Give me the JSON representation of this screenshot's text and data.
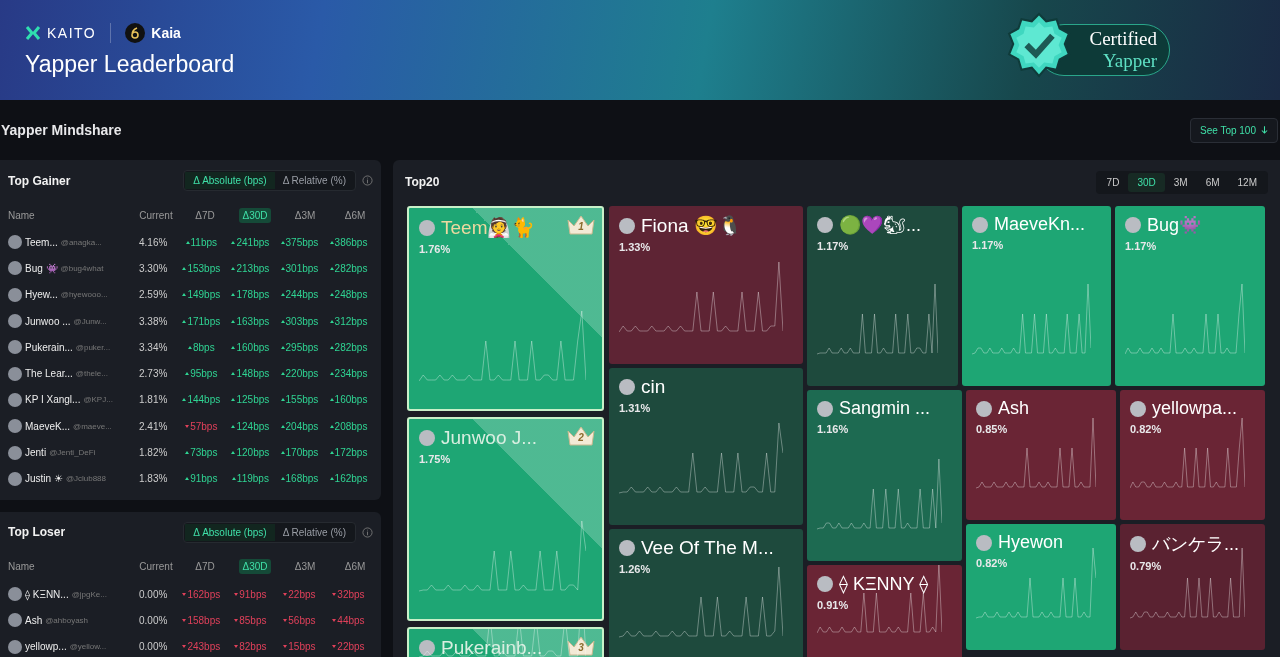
{
  "header": {
    "brand": "KAITO",
    "partner": "Kaia",
    "title": "Yapper Leaderboard",
    "badge": {
      "line1": "Certified",
      "line2": "Yapper"
    }
  },
  "section_title": "Yapper Mindshare",
  "see_top_button": "See Top 100",
  "panels": [
    {
      "title": "Top Gainer",
      "toggle": [
        {
          "label": "Δ Absolute (bps)",
          "selected": true
        },
        {
          "label": "Δ Relative (%)",
          "selected": false
        }
      ],
      "columns": [
        {
          "label": "Name",
          "selected": false
        },
        {
          "label": "Current",
          "selected": false
        },
        {
          "label": "Δ7D",
          "selected": false
        },
        {
          "label": "Δ30D",
          "selected": true
        },
        {
          "label": "Δ3M",
          "selected": false
        },
        {
          "label": "Δ6M",
          "selected": false
        }
      ],
      "rows": [
        {
          "name": "Teem...",
          "handle": "@anagka...",
          "current": "4.16%",
          "changes": [
            {
              "value": "11bps",
              "up": true
            },
            {
              "value": "241bps",
              "up": true
            },
            {
              "value": "375bps",
              "up": true
            },
            {
              "value": "386bps",
              "up": true
            }
          ]
        },
        {
          "name": "Bug 👾",
          "handle": "@bug4what",
          "current": "3.30%",
          "changes": [
            {
              "value": "153bps",
              "up": true
            },
            {
              "value": "213bps",
              "up": true
            },
            {
              "value": "301bps",
              "up": true
            },
            {
              "value": "282bps",
              "up": true
            }
          ]
        },
        {
          "name": "Hyew...",
          "handle": "@hyewooo...",
          "current": "2.59%",
          "changes": [
            {
              "value": "149bps",
              "up": true
            },
            {
              "value": "178bps",
              "up": true
            },
            {
              "value": "244bps",
              "up": true
            },
            {
              "value": "248bps",
              "up": true
            }
          ]
        },
        {
          "name": "Junwoo ...",
          "handle": "@Junw...",
          "current": "3.38%",
          "changes": [
            {
              "value": "171bps",
              "up": true
            },
            {
              "value": "163bps",
              "up": true
            },
            {
              "value": "303bps",
              "up": true
            },
            {
              "value": "312bps",
              "up": true
            }
          ]
        },
        {
          "name": "Pukerain...",
          "handle": "@puker...",
          "current": "3.34%",
          "changes": [
            {
              "value": "8bps",
              "up": true
            },
            {
              "value": "160bps",
              "up": true
            },
            {
              "value": "295bps",
              "up": true
            },
            {
              "value": "282bps",
              "up": true
            }
          ]
        },
        {
          "name": "The Lear...",
          "handle": "@thele...",
          "current": "2.73%",
          "changes": [
            {
              "value": "95bps",
              "up": true
            },
            {
              "value": "148bps",
              "up": true
            },
            {
              "value": "220bps",
              "up": true
            },
            {
              "value": "234bps",
              "up": true
            }
          ]
        },
        {
          "name": "KP I Xangl...",
          "handle": "@KPJ...",
          "current": "1.81%",
          "changes": [
            {
              "value": "144bps",
              "up": true
            },
            {
              "value": "125bps",
              "up": true
            },
            {
              "value": "155bps",
              "up": true
            },
            {
              "value": "160bps",
              "up": true
            }
          ]
        },
        {
          "name": "MaeveK...",
          "handle": "@maeve...",
          "current": "2.41%",
          "changes": [
            {
              "value": "57bps",
              "up": false
            },
            {
              "value": "124bps",
              "up": true
            },
            {
              "value": "204bps",
              "up": true
            },
            {
              "value": "208bps",
              "up": true
            }
          ]
        },
        {
          "name": "Jenti",
          "handle": "@Jenti_DeFi",
          "current": "1.82%",
          "changes": [
            {
              "value": "73bps",
              "up": true
            },
            {
              "value": "120bps",
              "up": true
            },
            {
              "value": "170bps",
              "up": true
            },
            {
              "value": "172bps",
              "up": true
            }
          ]
        },
        {
          "name": "Justin ☀",
          "handle": "@Jclub888",
          "current": "1.83%",
          "changes": [
            {
              "value": "91bps",
              "up": true
            },
            {
              "value": "119bps",
              "up": true
            },
            {
              "value": "168bps",
              "up": true
            },
            {
              "value": "162bps",
              "up": true
            }
          ]
        }
      ]
    },
    {
      "title": "Top Loser",
      "toggle": [
        {
          "label": "Δ Absolute (bps)",
          "selected": true
        },
        {
          "label": "Δ Relative (%)",
          "selected": false
        }
      ],
      "columns": [
        {
          "label": "Name",
          "selected": false
        },
        {
          "label": "Current",
          "selected": false
        },
        {
          "label": "Δ7D",
          "selected": false
        },
        {
          "label": "Δ30D",
          "selected": true
        },
        {
          "label": "Δ3M",
          "selected": false
        },
        {
          "label": "Δ6M",
          "selected": false
        }
      ],
      "rows": [
        {
          "name": "⟠ KΞNN...",
          "handle": "@jpgKe...",
          "current": "0.00%",
          "changes": [
            {
              "value": "162bps",
              "up": false
            },
            {
              "value": "91bps",
              "up": false
            },
            {
              "value": "22bps",
              "up": false
            },
            {
              "value": "32bps",
              "up": false
            }
          ]
        },
        {
          "name": "Ash",
          "handle": "@ahboyash",
          "current": "0.00%",
          "changes": [
            {
              "value": "158bps",
              "up": false
            },
            {
              "value": "85bps",
              "up": false
            },
            {
              "value": "56bps",
              "up": false
            },
            {
              "value": "44bps",
              "up": false
            }
          ]
        },
        {
          "name": "yellowp...",
          "handle": "@yellow...",
          "current": "0.00%",
          "changes": [
            {
              "value": "243bps",
              "up": false
            },
            {
              "value": "82bps",
              "up": false
            },
            {
              "value": "15bps",
              "up": false
            },
            {
              "value": "22bps",
              "up": false
            }
          ]
        }
      ]
    }
  ],
  "treemap": {
    "title": "Top20",
    "periods": [
      {
        "label": "7D",
        "selected": false
      },
      {
        "label": "30D",
        "selected": true
      },
      {
        "label": "3M",
        "selected": false
      },
      {
        "label": "6M",
        "selected": false
      },
      {
        "label": "12M",
        "selected": false
      }
    ],
    "tiles": [
      {
        "name": "Teem👰🐈",
        "share": "1.76%",
        "color": "#1ea674",
        "rank": "1"
      },
      {
        "name": "Junwoo J...",
        "share": "1.75%",
        "color": "#1ea674",
        "rank": "2"
      },
      {
        "name": "Pukerainb...",
        "color": "#1ea674",
        "rank": "3"
      },
      {
        "name": "Fiona 🤓🐧",
        "share": "1.33%",
        "color": "#5e2434"
      },
      {
        "name": "cin",
        "share": "1.31%",
        "color": "#1e4a3d"
      },
      {
        "name": "Vee Of The M...",
        "share": "1.26%",
        "color": "#1e4a3d"
      },
      {
        "name": "🟢💜🐿...",
        "share": "1.17%",
        "color": "#1e4a3d"
      },
      {
        "name": "MaeveKn...",
        "share": "1.17%",
        "color": "#1ea674"
      },
      {
        "name": "Bug👾",
        "share": "1.17%",
        "color": "#1ea674"
      },
      {
        "name": "Sangmin ...",
        "share": "1.16%",
        "color": "#1d6a51"
      },
      {
        "name": "Ash",
        "share": "0.85%",
        "color": "#6a2535"
      },
      {
        "name": "yellowpa...",
        "share": "0.82%",
        "color": "#6a2535"
      },
      {
        "name": "Hyewon",
        "share": "0.82%",
        "color": "#1ea674"
      },
      {
        "name": "バンケラ...",
        "share": "0.79%",
        "color": "#5a2231"
      },
      {
        "name": "⟠ KΞNNY ⟠",
        "share": "0.91%",
        "color": "#6a2535"
      }
    ]
  }
}
